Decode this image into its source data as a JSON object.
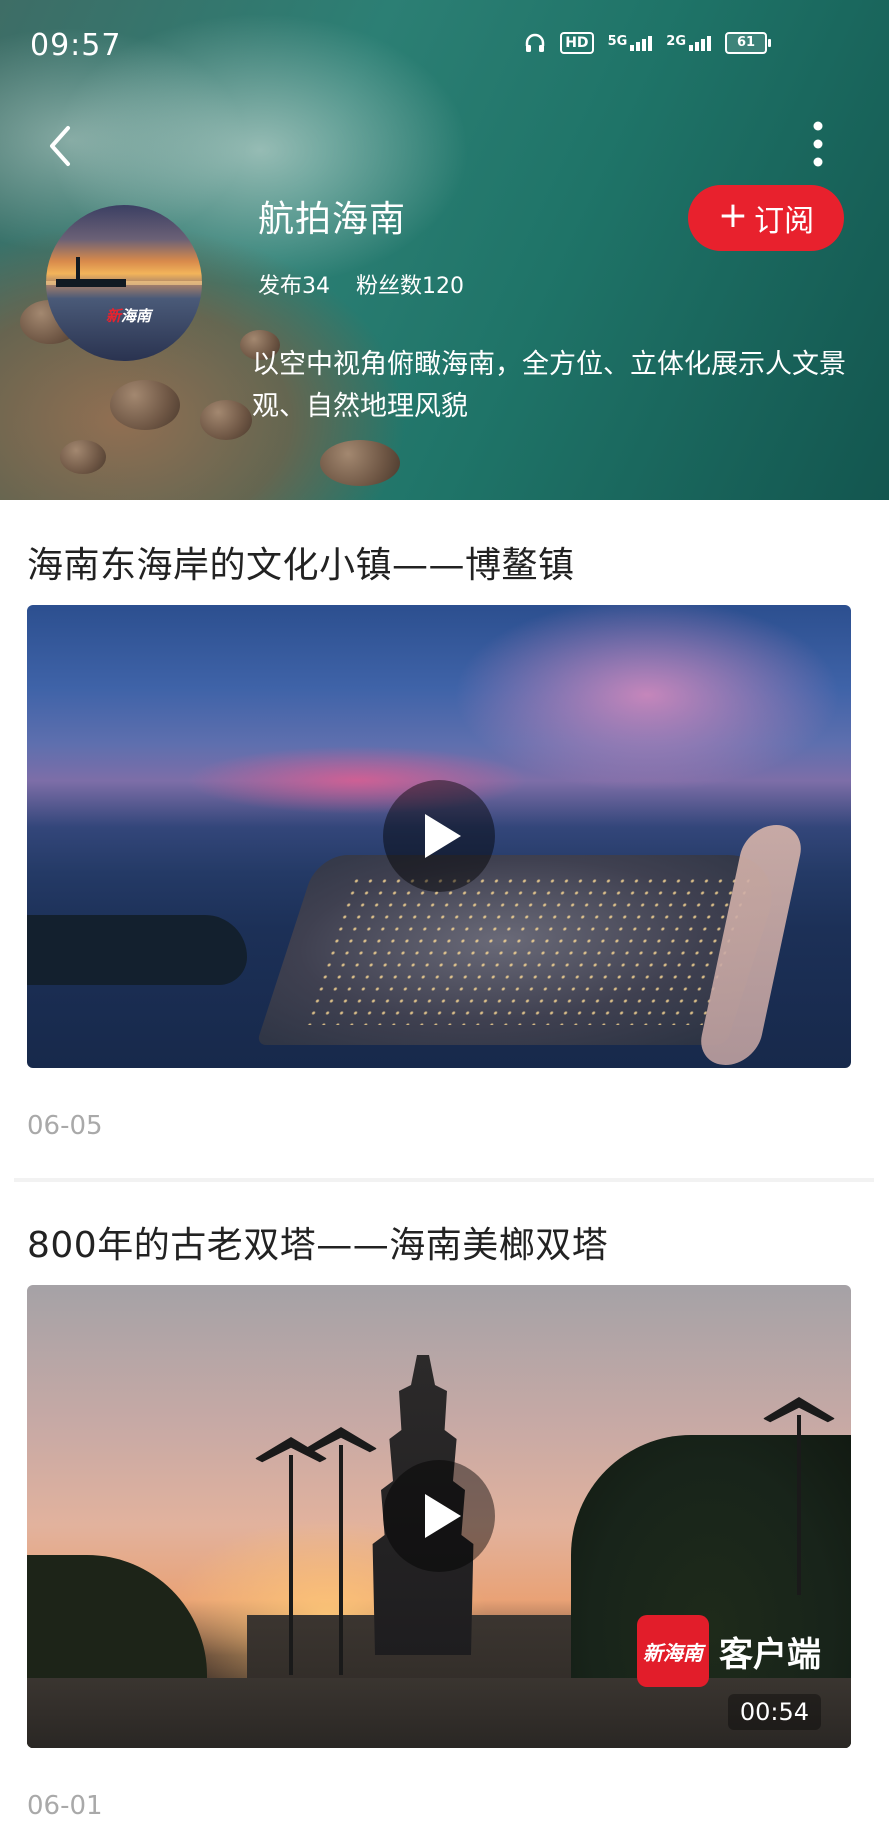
{
  "status_bar": {
    "time": "09:57",
    "hd": "HD",
    "network_1": "5G",
    "network_2": "2G",
    "battery": "61"
  },
  "header": {
    "channel_name": "航拍海南",
    "subscribe_label": "订阅",
    "stats": {
      "posts": "发布34",
      "followers": "粉丝数120"
    },
    "avatar_logo": {
      "red": "新",
      "white": "海南"
    },
    "description": "以空中视角俯瞰海南，全方位、立体化展示人文景观、自然地理风貌"
  },
  "articles": [
    {
      "title": "海南东海岸的文化小镇——博鳌镇",
      "date": "06-05"
    },
    {
      "title": "800年的古老双塔——海南美榔双塔",
      "date": "06-01",
      "duration": "00:54",
      "watermark_logo": "新海南",
      "watermark_text": "客户端"
    }
  ],
  "colors": {
    "accent": "#e8212d",
    "title_text": "#222222",
    "date_text": "#a9a9a9"
  }
}
